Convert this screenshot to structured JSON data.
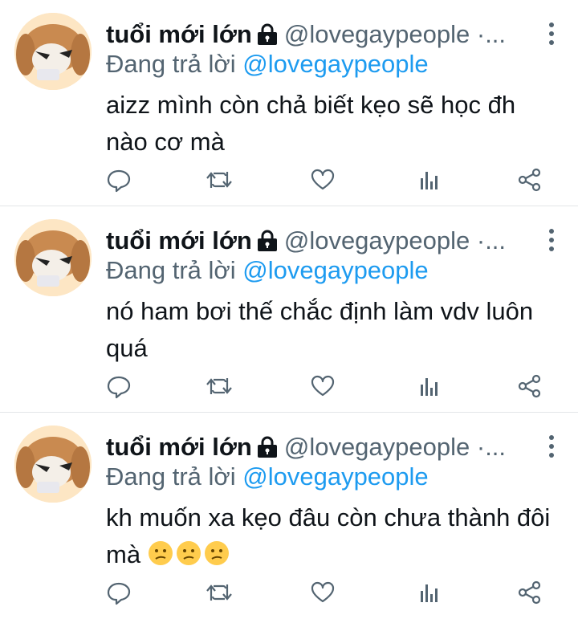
{
  "tweets": [
    {
      "name": "tuổi mới lớn",
      "handle": "@lovegaypeople ·...",
      "reply_prefix": "Đang trả lời",
      "reply_mention": "@lovegaypeople",
      "text": "aizz mình còn chả biết kẹo sẽ học đh nào cơ mà",
      "emojis": []
    },
    {
      "name": "tuổi mới lớn",
      "handle": "@lovegaypeople ·...",
      "reply_prefix": "Đang trả lời",
      "reply_mention": "@lovegaypeople",
      "text": "nó ham bơi thế chắc định làm vdv luôn quá",
      "emojis": []
    },
    {
      "name": "tuổi mới lớn",
      "handle": "@lovegaypeople ·...",
      "reply_prefix": "Đang trả lời",
      "reply_mention": "@lovegaypeople",
      "text": "kh muốn xa kẹo đâu còn chưa thành đôi mà ",
      "emojis": [
        "confused-face-icon",
        "confused-face-icon",
        "confused-face-icon"
      ]
    }
  ],
  "colors": {
    "text": "#0f1419",
    "secondary": "#536471",
    "mention": "#1d9bf0",
    "divider": "#e3e6e8"
  },
  "icons": [
    "protected-lock-icon",
    "more-options-icon",
    "reply-icon",
    "retweet-icon",
    "like-icon",
    "analytics-icon",
    "share-icon"
  ]
}
